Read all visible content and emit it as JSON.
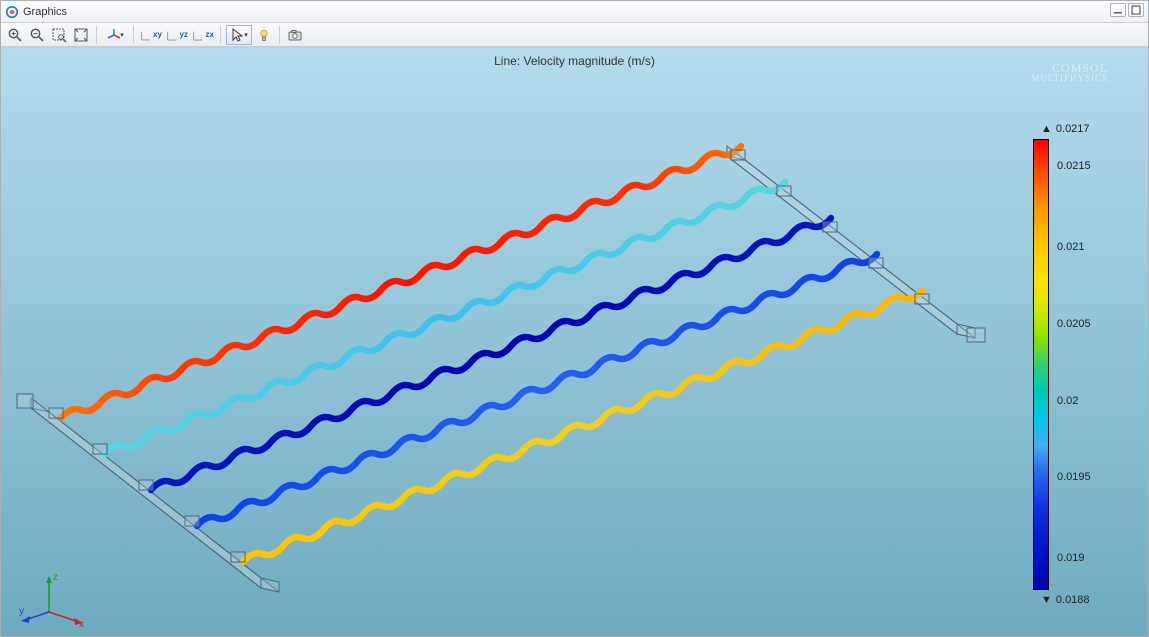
{
  "window": {
    "title": "Graphics"
  },
  "toolbar": {
    "dd_text": "▾"
  },
  "viewport": {
    "title": "Line: Velocity magnitude (m/s)",
    "watermark_line1": "COMSOL",
    "watermark_line2": "MULTIPHYSICS",
    "axes": {
      "x": "x",
      "y": "y",
      "z": "z"
    }
  },
  "colorbar": {
    "max": "0.0217",
    "min": "0.0188",
    "ticks": [
      {
        "label": "0.0215",
        "pos": 6
      },
      {
        "label": "0.021",
        "pos": 24
      },
      {
        "label": "0.0205",
        "pos": 41
      },
      {
        "label": "0.02",
        "pos": 58
      },
      {
        "label": "0.0195",
        "pos": 75
      },
      {
        "label": "0.019",
        "pos": 93
      }
    ]
  },
  "chart_data": {
    "type": "line",
    "quantity": "Velocity magnitude",
    "unit": "m/s",
    "coloring": "sequential (blue→cyan→green→yellow→orange→red)",
    "range": [
      0.0188,
      0.0217
    ],
    "channels": [
      {
        "index": 1,
        "approx_value": 0.0217,
        "color": "red"
      },
      {
        "index": 2,
        "approx_value": 0.0198,
        "color": "cyan"
      },
      {
        "index": 3,
        "approx_value": 0.0189,
        "color": "dark-blue"
      },
      {
        "index": 4,
        "approx_value": 0.0192,
        "color": "blue"
      },
      {
        "index": 5,
        "approx_value": 0.0208,
        "color": "yellow-orange"
      }
    ]
  }
}
